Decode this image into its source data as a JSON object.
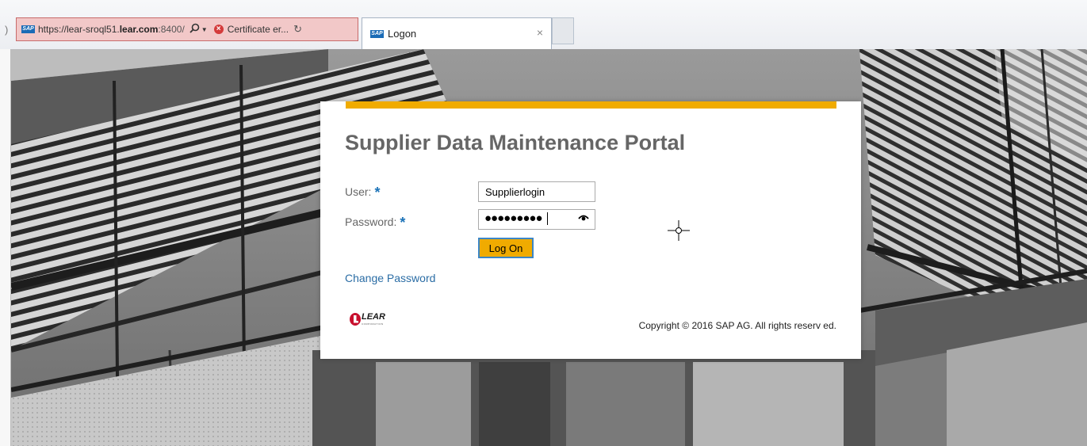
{
  "browser": {
    "address_bar": {
      "url_prefix": "https://lear-sroql51.",
      "url_domain": "lear.com",
      "url_port": ":8400/",
      "certificate_text": "Certificate er...",
      "favicon": "SAP",
      "search_icon": "search-icon",
      "certificate_icon": "certificate-error-icon",
      "refresh_icon": "refresh-icon"
    },
    "tabs": [
      {
        "favicon": "SAP",
        "label": "Logon",
        "close_label": "×"
      }
    ]
  },
  "logon": {
    "title": "Supplier Data Maintenance Portal",
    "user_label": "User:",
    "password_label": "Password:",
    "required_mark": "*",
    "user_value": "Supplierlogin",
    "password_masked": "●●●●●●●●●",
    "logon_button": "Log On",
    "change_password": "Change Password",
    "copyright": "Copyright © 2016 SAP AG. All rights reserv ed.",
    "logo": {
      "name": "LEAR",
      "subtext": "CORPORATION"
    }
  },
  "colors": {
    "accent_bar": "#f0ab00",
    "button_bg": "#f0ab00",
    "link": "#2b6da5",
    "required": "#1c73b8",
    "cert_error_bg": "#f2c8c8"
  }
}
